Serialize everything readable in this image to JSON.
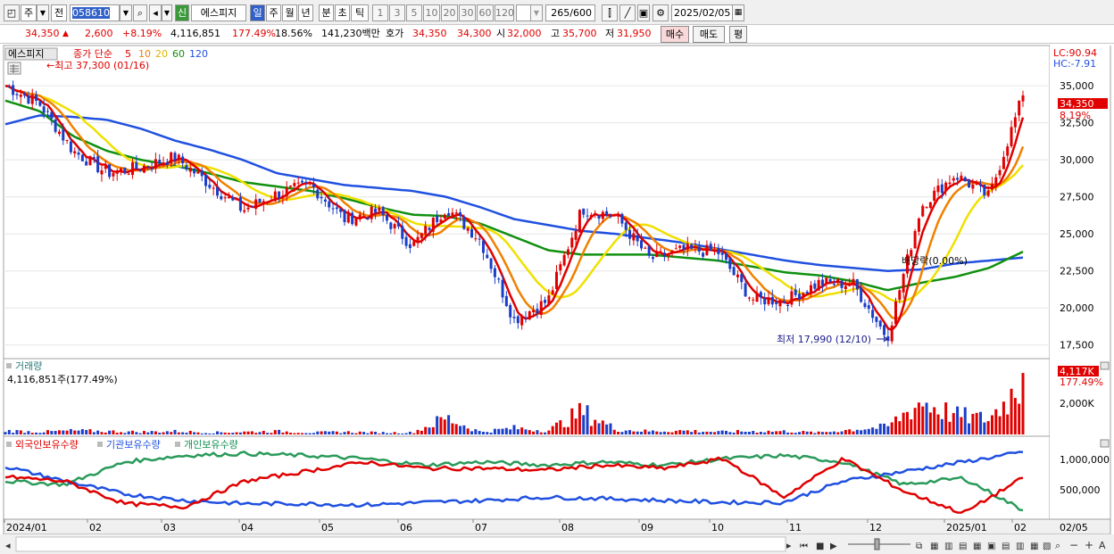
{
  "toolbar": {
    "ju": "주",
    "jeon": "전",
    "code": "058610",
    "sin": "신",
    "name": "에스피지",
    "periods": [
      "일",
      "주",
      "월",
      "년",
      "분",
      "초",
      "틱"
    ],
    "nums": [
      "1",
      "3",
      "5",
      "10",
      "20",
      "30",
      "60",
      "120"
    ],
    "count": "265",
    "count_total": "/600",
    "date": "2025/02/05"
  },
  "info": {
    "price": "34,350",
    "up_arrow": "▲",
    "change": "2,600",
    "change_pct": "+8.19%",
    "volume": "4,116,851",
    "vol_ratio": "177.49%",
    "turnover": "18.56%",
    "amount": "141,230백만",
    "hoga_label": "호가",
    "hoga_ask": "34,350",
    "hoga_bid": "34,300",
    "open_label": "시",
    "open": "32,000",
    "high_label": "고",
    "high": "35,700",
    "low_label": "저",
    "low": "31,950",
    "buy": "매수",
    "sell": "매도",
    "pyeong": "평"
  },
  "legend": {
    "name": "에스피지",
    "ma_label": "종가 단순",
    "ma_periods": [
      "5",
      "10",
      "20",
      "60",
      "120"
    ],
    "ma_colors": [
      "#e00000",
      "#f08000",
      "#e0c000",
      "#109010",
      "#2050e0"
    ],
    "high_note": "←최고 37,300 (01/16)",
    "low_note": "최저 17,990 (12/10)",
    "dividend_note": "배당락(0.00%)",
    "lc": "LC:90.94",
    "hc": "HC:-7.91",
    "price_tag": "34,350",
    "pct_tag": "8.19%"
  },
  "volume_panel": {
    "title": "거래량",
    "value": "4,116,851주(177.49%)",
    "tag": "4,117K",
    "tag_pct": "177.49%",
    "axis": "2,000K"
  },
  "holding_panel": {
    "foreign": "외국인보유수량",
    "inst": "기관보유수량",
    "indiv": "개인보유수량",
    "axis": [
      "1,000,000",
      "500,000"
    ]
  },
  "months": [
    "2024/01",
    "02",
    "03",
    "04",
    "05",
    "06",
    "07",
    "08",
    "09",
    "10",
    "11",
    "12",
    "2025/01",
    "02"
  ],
  "end_date": "02/05",
  "chart_data": {
    "type": "line",
    "title": "에스피지 종가",
    "y_ticks": [
      35000,
      32500,
      30000,
      27500,
      25000,
      22500,
      20000,
      17500
    ],
    "ylim": [
      16700,
      37600
    ],
    "x": [
      "2024/01",
      "2024/01",
      "2024/02",
      "2024/02",
      "2024/03",
      "2024/03",
      "2024/04",
      "2024/04",
      "2024/05",
      "2024/05",
      "2024/06",
      "2024/06",
      "2024/07",
      "2024/07",
      "2024/07",
      "2024/08",
      "2024/08",
      "2024/08",
      "2024/09",
      "2024/09",
      "2024/10",
      "2024/10",
      "2024/11",
      "2024/11",
      "2024/12",
      "2024/12",
      "2024/12",
      "2025/01",
      "2025/01",
      "2025/01",
      "2025/02"
    ],
    "series": [
      {
        "name": "종가",
        "values": [
          35000,
          33800,
          30600,
          29100,
          29500,
          30200,
          28400,
          26600,
          27700,
          28300,
          26000,
          26500,
          24200,
          26800,
          24600,
          19200,
          20500,
          26700,
          26200,
          23300,
          23900,
          23800,
          20600,
          20500,
          21700,
          21600,
          18000,
          26900,
          29000,
          27500,
          34350
        ]
      },
      {
        "name": "120",
        "values": [
          32400,
          33000,
          32900,
          32700,
          32100,
          31300,
          30700,
          30000,
          29100,
          28700,
          28300,
          28100,
          27900,
          27500,
          26800,
          26000,
          25600,
          25200,
          25000,
          24700,
          24400,
          24000,
          23600,
          23200,
          22900,
          22700,
          22500,
          22600,
          23000,
          23200,
          23400
        ]
      },
      {
        "name": "60",
        "values": [
          34000,
          33300,
          31600,
          30600,
          30000,
          29600,
          29100,
          28500,
          28200,
          27900,
          27400,
          26800,
          26300,
          26200,
          25700,
          24800,
          23900,
          23600,
          23600,
          23600,
          23400,
          23200,
          22800,
          22400,
          22200,
          21800,
          21200,
          21700,
          22100,
          22700,
          23800
        ]
      }
    ],
    "volume_k": [
      300,
      200,
      300,
      250,
      200,
      250,
      150,
      200,
      250,
      150,
      200,
      150,
      150,
      1300,
      200,
      500,
      300,
      1800,
      400,
      250,
      300,
      200,
      250,
      250,
      150,
      400,
      600,
      2600,
      1500,
      1200,
      4117
    ]
  }
}
